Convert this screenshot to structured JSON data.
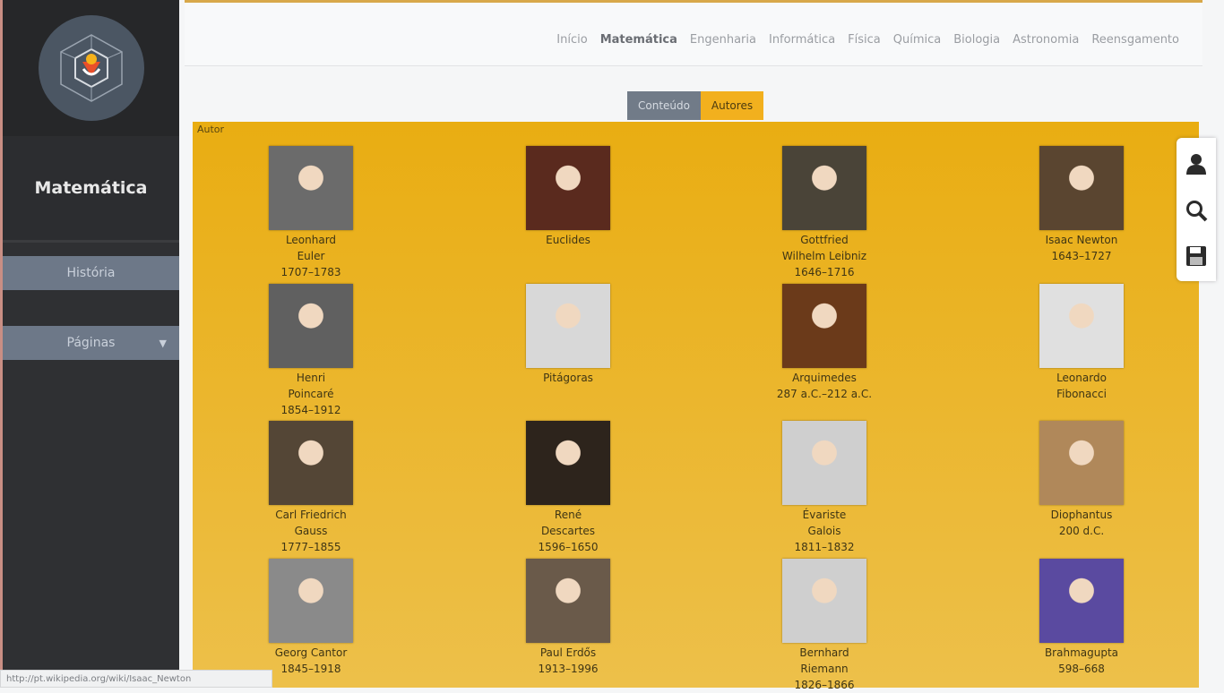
{
  "sidebar": {
    "title": "Matemática",
    "items": [
      {
        "label": "História"
      },
      {
        "label": "Páginas",
        "chevron": "chevron-down-icon"
      }
    ]
  },
  "topnav": [
    "Início",
    "Matemática",
    "Engenharia",
    "Informática",
    "Física",
    "Química",
    "Biologia",
    "Astronomia",
    "Reensgamento"
  ],
  "tabs": {
    "conteudo": "Conteúdo",
    "autores": "Autores"
  },
  "content_heading": "Autor",
  "authors": [
    {
      "name1": "Leonhard",
      "name2": "Euler",
      "years": "1707–1783"
    },
    {
      "name1": "Euclides",
      "name2": "",
      "years": ""
    },
    {
      "name1": "Gottfried",
      "name2": "Wilhelm Leibniz",
      "years": "1646–1716"
    },
    {
      "name1": "Isaac Newton",
      "name2": "1643–1727",
      "years": ""
    },
    {
      "name1": "Henri",
      "name2": "Poincaré",
      "years": "1854–1912"
    },
    {
      "name1": "Pitágoras",
      "name2": "",
      "years": ""
    },
    {
      "name1": "Arquimedes",
      "name2": "287 a.C.–212 a.C.",
      "years": ""
    },
    {
      "name1": "Leonardo",
      "name2": "Fibonacci",
      "years": ""
    },
    {
      "name1": "Carl Friedrich",
      "name2": "Gauss",
      "years": "1777–1855"
    },
    {
      "name1": "René",
      "name2": "Descartes",
      "years": "1596–1650"
    },
    {
      "name1": "Évariste",
      "name2": "Galois",
      "years": "1811–1832"
    },
    {
      "name1": "Diophantus",
      "name2": "200 d.C.",
      "years": ""
    },
    {
      "name1": "Georg Cantor",
      "name2": "1845–1918",
      "years": ""
    },
    {
      "name1": "Paul Erdős",
      "name2": "1913–1996",
      "years": ""
    },
    {
      "name1": "Bernhard",
      "name2": "Riemann",
      "years": "1826–1866"
    },
    {
      "name1": "Brahmagupta",
      "name2": "598–668",
      "years": ""
    }
  ],
  "tools": [
    "user-icon",
    "search-icon",
    "save-icon"
  ],
  "status_bar": "http://pt.wikipedia.org/wiki/Isaac_Newton",
  "colors": {
    "accent": "#f2b01e",
    "sidebar": "#2f3033",
    "button": "#6d7888"
  }
}
